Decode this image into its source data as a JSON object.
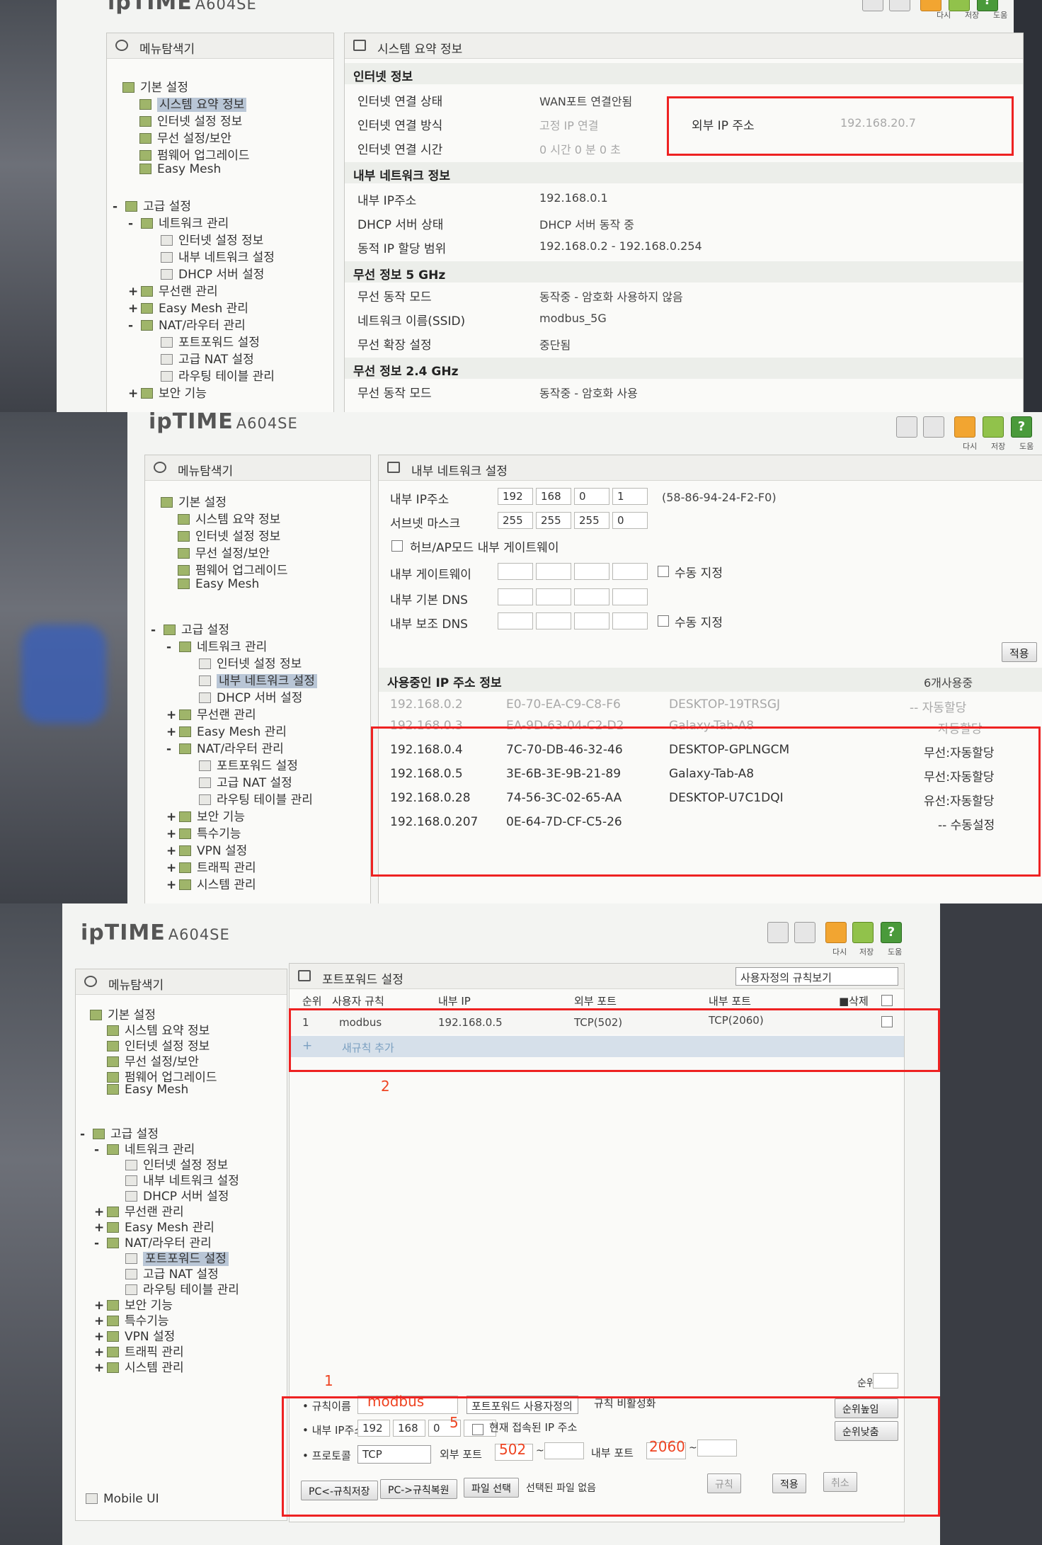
{
  "common": {
    "brand": "ipTIME",
    "model": "A604SE",
    "menu_explorer": "메뉴탐색기",
    "top_buttons": [
      "다시",
      "저장",
      "도움"
    ],
    "help_glyph": "?",
    "tree": {
      "basic": "기본 설정",
      "system_summary": "시스템 요약 정보",
      "internet_setup": "인터넷 설정 정보",
      "wireless_security": "무선 설정/보안",
      "firmware": "펌웨어 업그레이드",
      "easy_mesh": "Easy Mesh",
      "advanced": "고급 설정",
      "network_mgmt": "네트워크 관리",
      "internet_setup2": "인터넷 설정 정보",
      "lan_setup": "내부 네트워크 설정",
      "dhcp": "DHCP 서버 설정",
      "wlan_mgmt": "무선랜 관리",
      "easy_mesh_mgmt": "Easy Mesh 관리",
      "nat_mgmt": "NAT/라우터 관리",
      "port_forward": "포트포워드 설정",
      "adv_nat": "고급 NAT 설정",
      "routing": "라우팅 테이블 관리",
      "security": "보안 기능",
      "special": "특수기능",
      "vpn": "VPN 설정",
      "traffic": "트래픽 관리",
      "sysmgmt": "시스템 관리"
    },
    "plus": "+",
    "minus": "-"
  },
  "panel1": {
    "title": "시스템 요약 정보",
    "internet_section": "인터넷 정보",
    "rows": [
      {
        "label": "인터넷 연결 상태",
        "value": "WAN포트 연결안됨"
      },
      {
        "label": "인터넷 연결 방식",
        "value": "고정 IP 연결"
      },
      {
        "label": "인터넷 연결 시간",
        "value": "0 시간 0 분 0 초"
      }
    ],
    "wan_ip_label": "외부 IP 주소",
    "wan_ip_value": "192.168.20.7",
    "lan_section": "내부 네트워크 정보",
    "lan_rows": [
      {
        "label": "내부 IP주소",
        "value": "192.168.0.1"
      },
      {
        "label": "DHCP 서버 상태",
        "value": "DHCP 서버 동작 중"
      },
      {
        "label": "동적 IP 할당 범위",
        "value": "192.168.0.2 -  192.168.0.254"
      }
    ],
    "w5_section": "무선 정보 5 GHz",
    "w5_rows": [
      {
        "label": "무선 동작 모드",
        "value": "동작중 - 암호화 사용하지 않음"
      },
      {
        "label": "네트워크 이름(SSID)",
        "value": "modbus_5G"
      },
      {
        "label": "무선 확장 설정",
        "value": "중단됨"
      }
    ],
    "w24_section": "무선 정보 2.4 GHz",
    "w24_rows": [
      {
        "label": "무선 동작 모드",
        "value": "동작중 - 암호화 사용"
      }
    ]
  },
  "panel2": {
    "title": "내부 네트워크 설정",
    "lan_ip_label": "내부 IP주소",
    "lan_ip": [
      "192",
      "168",
      "0",
      "1"
    ],
    "mac": "(58-86-94-24-F2-F0)",
    "subnet_label": "서브넷 마스크",
    "subnet": [
      "255",
      "255",
      "255",
      "0"
    ],
    "hub_ap_label": "허브/AP모드 내부 게이트웨이",
    "gw_label": "내부 게이트웨이",
    "dns1_label": "내부 기본 DNS",
    "dns2_label": "내부 보조 DNS",
    "manual_label": "수동 지정",
    "apply": "적용",
    "inuse_title": "사용중인 IP 주소 정보",
    "inuse_count": "6개사용중",
    "clients": [
      {
        "ip": "192.168.0.2",
        "mac": "E0-70-EA-C9-C8-F6",
        "name": "DESKTOP-19TRSGJ",
        "type": "-- 자동할당",
        "faded": true
      },
      {
        "ip": "192.168.0.3",
        "mac": "EA-9D-63-04-C2-D2",
        "name": "Galaxy-Tab-A8",
        "type": "자동할당",
        "faded": true
      },
      {
        "ip": "192.168.0.4",
        "mac": "7C-70-DB-46-32-46",
        "name": "DESKTOP-GPLNGCM",
        "type": "무선:자동할당",
        "faded": false
      },
      {
        "ip": "192.168.0.5",
        "mac": "3E-6B-3E-9B-21-89",
        "name": "Galaxy-Tab-A8",
        "type": "무선:자동할당",
        "faded": false
      },
      {
        "ip": "192.168.0.28",
        "mac": "74-56-3C-02-65-AA",
        "name": "DESKTOP-U7C1DQI",
        "type": "유선:자동할당",
        "faded": false
      },
      {
        "ip": "192.168.0.207",
        "mac": "0E-64-7D-CF-C5-26",
        "name": "",
        "type": "-- 수동설정",
        "faded": false
      }
    ]
  },
  "panel3": {
    "title": "포트포워드 설정",
    "view_select": "사용자정의 규칙보기",
    "columns": {
      "rank": "순위",
      "rule": "사용자 규칙",
      "ip": "내부 IP",
      "ext": "외부 포트",
      "int": "내부 포트",
      "del": "■삭제"
    },
    "rule_row": {
      "rank": "1",
      "name": "modbus",
      "ip": "192.168.0.5",
      "ext": "TCP(502)",
      "int": "TCP(2060)"
    },
    "add_rule": "새규칙 추가",
    "rank_label": "순위",
    "form": {
      "name_label": "규칙이름",
      "name_value": "modbus",
      "type_select": "포트포워드 사용자정의",
      "disable_label": "규칙 비활성화",
      "ip_label": "내부 IP주소",
      "ip": [
        "192",
        "168",
        "0",
        ""
      ],
      "current_ip_label": "현재 접속된 IP 주소",
      "proto_label": "프로토콜",
      "proto_value": "TCP",
      "ext_label": "외부 포트",
      "ext_value": "502",
      "int_label": "내부 포트",
      "int_value": "2060",
      "tilde": "~",
      "rank_up": "순위높임",
      "rank_down": "순위낮춤",
      "save_pc": "PC<-규칙저장",
      "restore_pc": "PC->규칙복원",
      "file_select": "파일 선택",
      "no_file": "선택된 파일 없음",
      "add_btn": "규칙",
      "apply_btn": "적용",
      "cancel_btn": "취소"
    },
    "mobile_ui": "Mobile UI"
  },
  "annotations": {
    "n1": "1",
    "n2": "2",
    "n5": "5"
  },
  "colors": {
    "highlight_red": "#e22222",
    "selected_menu": "#b9c6d6",
    "annotation_red": "#e44422"
  }
}
